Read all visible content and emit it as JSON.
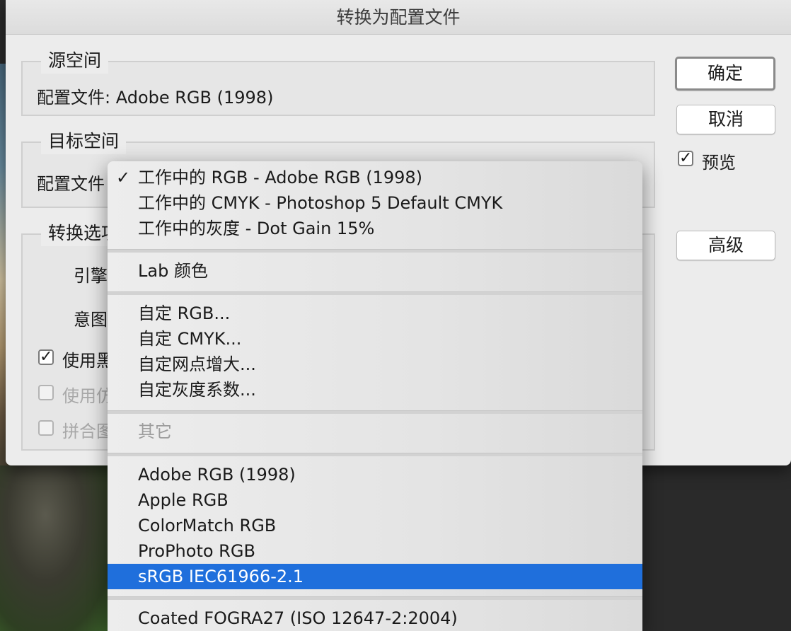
{
  "dialog": {
    "title": "转换为配置文件",
    "source": {
      "label": "源空间",
      "profile_line": "配置文件:  Adobe RGB (1998)"
    },
    "destination": {
      "label": "目标空间",
      "profile_label": "配置文件"
    },
    "options": {
      "label": "转换选项",
      "engine_label": "引擎",
      "intent_label": "意图",
      "use_black_label": "使用黑",
      "use_dither_label": "使用仿",
      "flatten_label": "拼合图"
    },
    "buttons": {
      "ok": "确定",
      "cancel": "取消",
      "preview": "预览",
      "advanced": "高级"
    },
    "checkbox_mark": "✓"
  },
  "menu": {
    "check_mark": "✓",
    "working": [
      "工作中的 RGB - Adobe RGB (1998)",
      "工作中的 CMYK - Photoshop 5 Default CMYK",
      "工作中的灰度 - Dot Gain 15%"
    ],
    "lab": "Lab 颜色",
    "custom": [
      "自定 RGB...",
      "自定 CMYK...",
      "自定网点增大...",
      "自定灰度系数..."
    ],
    "other": "其它",
    "profiles": [
      "Adobe RGB (1998)",
      "Apple RGB",
      "ColorMatch RGB",
      "ProPhoto RGB",
      "sRGB IEC61966-2.1"
    ],
    "cmyk_first": "Coated FOGRA27 (ISO 12647-2:2004)",
    "selected_color": "#1f6fdc"
  }
}
